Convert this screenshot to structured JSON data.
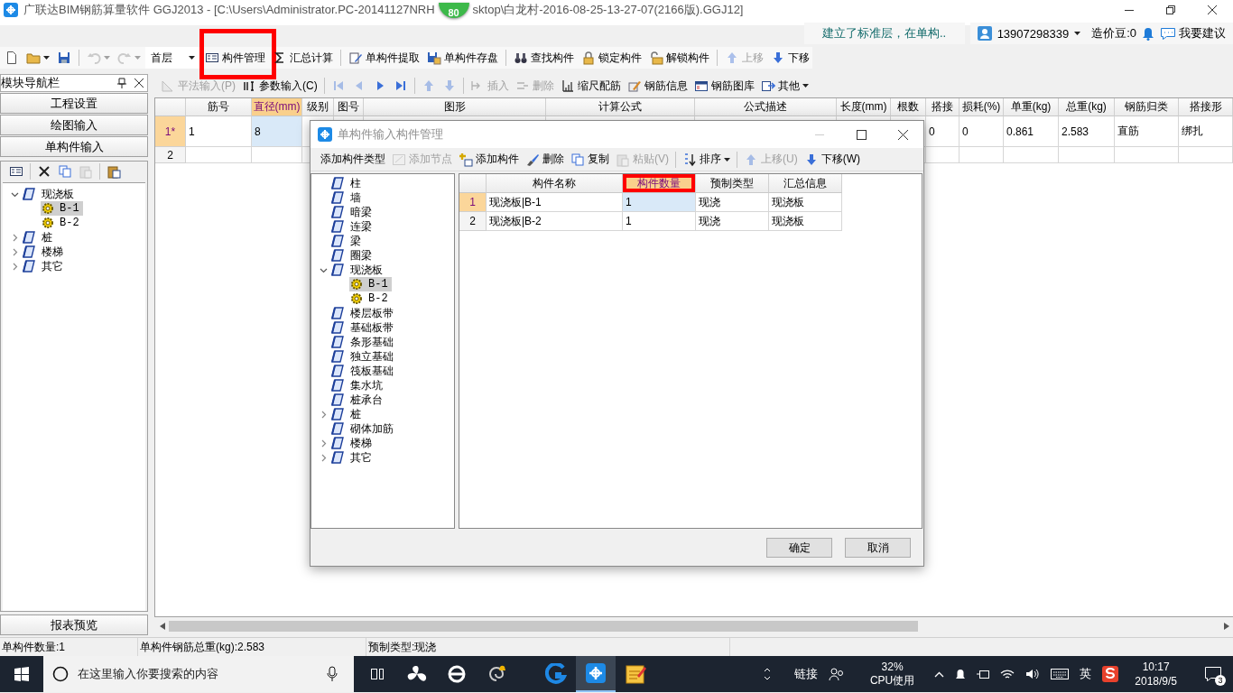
{
  "window": {
    "title_parts": [
      "广联达BIM钢筋算量软件 GGJ2013 - [C:\\Users\\Administrator.PC-20141127NRH",
      "sktop\\白龙村-2016-08-25-13-27-07(2166版).GGJ12]"
    ],
    "badge": "80"
  },
  "info_bar": {
    "notice": "建立了标准层，在单构..",
    "user": "13907298339",
    "beans": "造价豆:0",
    "feedback": "我要建议"
  },
  "toolbar": [
    {
      "kind": "icon",
      "disabled": false
    },
    {
      "kind": "icon",
      "disabled": false,
      "menu": true
    },
    {
      "kind": "icon",
      "disabled": false
    },
    {
      "kind": "separator"
    },
    {
      "kind": "icon",
      "disabled": true,
      "menu": true
    },
    {
      "kind": "icon",
      "disabled": true,
      "menu": true
    },
    {
      "kind": "dropdown",
      "label": "首层"
    },
    {
      "kind": "button",
      "label": "构件管理",
      "disabled": false,
      "highlighted": true
    },
    {
      "kind": "button",
      "label": "汇总计算",
      "disabled": false
    },
    {
      "kind": "separator"
    },
    {
      "kind": "button",
      "label": "单构件提取",
      "disabled": false
    },
    {
      "kind": "button",
      "label": "单构件存盘",
      "disabled": false
    },
    {
      "kind": "separator"
    },
    {
      "kind": "button",
      "label": "查找构件",
      "disabled": false
    },
    {
      "kind": "button",
      "label": "锁定构件",
      "disabled": false
    },
    {
      "kind": "button",
      "label": "解锁构件",
      "disabled": false
    },
    {
      "kind": "separator"
    },
    {
      "kind": "button",
      "label": "上移",
      "disabled": true
    },
    {
      "kind": "button",
      "label": "下移",
      "disabled": false
    }
  ],
  "nav": {
    "title": "模块导航栏",
    "sections": [
      "工程设置",
      "绘图输入",
      "单构件输入"
    ],
    "toolbar": [
      {
        "kind": "icon",
        "disabled": false
      },
      {
        "kind": "separator"
      },
      {
        "kind": "icon",
        "disabled": false
      },
      {
        "kind": "icon",
        "disabled": false
      },
      {
        "kind": "icon",
        "disabled": true
      },
      {
        "kind": "separator"
      },
      {
        "kind": "icon",
        "disabled": false
      }
    ],
    "tree": [
      {
        "label": "现浇板",
        "kind": "category",
        "expanded": true,
        "selected": false,
        "children": [
          {
            "label": "B-1",
            "kind": "component",
            "selected": true
          },
          {
            "label": "B-2",
            "kind": "component",
            "selected": false
          }
        ]
      },
      {
        "label": "桩",
        "kind": "category",
        "expanded": false,
        "selected": false
      },
      {
        "label": "楼梯",
        "kind": "category",
        "expanded": false,
        "selected": false
      },
      {
        "label": "其它",
        "kind": "category",
        "expanded": false,
        "selected": false
      }
    ],
    "footer": "报表预览"
  },
  "grid_toolbar": [
    {
      "kind": "button",
      "label": "平法输入(P)",
      "disabled": true
    },
    {
      "kind": "button",
      "label": "参数输入(C)",
      "disabled": false
    },
    {
      "kind": "separator"
    },
    {
      "kind": "icon",
      "disabled": true
    },
    {
      "kind": "icon",
      "disabled": true
    },
    {
      "kind": "icon",
      "disabled": false
    },
    {
      "kind": "icon",
      "disabled": false
    },
    {
      "kind": "separator"
    },
    {
      "kind": "icon",
      "disabled": true
    },
    {
      "kind": "icon",
      "disabled": true
    },
    {
      "kind": "separator"
    },
    {
      "kind": "button",
      "label": "插入",
      "disabled": true
    },
    {
      "kind": "button",
      "label": "删除",
      "disabled": true
    },
    {
      "kind": "button",
      "label": "缩尺配筋",
      "disabled": false
    },
    {
      "kind": "button",
      "label": "钢筋信息",
      "disabled": false
    },
    {
      "kind": "button",
      "label": "钢筋图库",
      "disabled": false
    },
    {
      "kind": "button",
      "label": "其他",
      "disabled": false,
      "menu": true
    }
  ],
  "grid": {
    "columns": [
      {
        "label": "筋号",
        "selected": false
      },
      {
        "label": "直径(mm)",
        "selected": true
      },
      {
        "label": "级别",
        "selected": false
      },
      {
        "label": "图号",
        "selected": false
      },
      {
        "label": "图形",
        "selected": false
      },
      {
        "label": "计算公式",
        "selected": false
      },
      {
        "label": "公式描述",
        "selected": false
      },
      {
        "label": "长度(mm)",
        "selected": false
      },
      {
        "label": "根数",
        "selected": false
      },
      {
        "label": "搭接",
        "selected": false
      },
      {
        "label": "损耗(%)",
        "selected": false
      },
      {
        "label": "单重(kg)",
        "selected": false
      },
      {
        "label": "总重(kg)",
        "selected": false
      },
      {
        "label": "钢筋归类",
        "selected": false
      },
      {
        "label": "搭接形",
        "selected": false
      }
    ],
    "rows": [
      {
        "header": "1*",
        "selected": true,
        "cells": [
          "1",
          "8",
          null,
          null,
          null,
          null,
          null,
          null,
          null,
          "0",
          "0",
          "0.861",
          "2.583",
          "直筋",
          "绑扎"
        ]
      },
      {
        "header": "2",
        "selected": false
      }
    ]
  },
  "dialog": {
    "title": "单构件输入构件管理",
    "toolbar": [
      {
        "kind": "button",
        "label": "添加构件类型",
        "disabled": false
      },
      {
        "kind": "button",
        "label": "添加节点",
        "disabled": true
      },
      {
        "kind": "button",
        "label": "添加构件",
        "disabled": false
      },
      {
        "kind": "button",
        "label": "删除",
        "disabled": false
      },
      {
        "kind": "button",
        "label": "复制",
        "disabled": false
      },
      {
        "kind": "button",
        "label": "粘贴(V)",
        "disabled": true
      },
      {
        "kind": "separator"
      },
      {
        "kind": "button",
        "label": "排序",
        "disabled": false,
        "menu": true
      },
      {
        "kind": "separator"
      },
      {
        "kind": "button",
        "label": "上移(U)",
        "disabled": true
      },
      {
        "kind": "button",
        "label": "下移(W)",
        "disabled": false
      }
    ],
    "tree": [
      {
        "label": "柱",
        "kind": "category",
        "selected": false
      },
      {
        "label": "墙",
        "kind": "category",
        "selected": false
      },
      {
        "label": "暗梁",
        "kind": "category",
        "selected": false
      },
      {
        "label": "连梁",
        "kind": "category",
        "selected": false
      },
      {
        "label": "梁",
        "kind": "category",
        "selected": false
      },
      {
        "label": "圈梁",
        "kind": "category",
        "selected": false
      },
      {
        "label": "现浇板",
        "kind": "category",
        "expanded": true,
        "selected": false,
        "children": [
          {
            "label": "B-1",
            "kind": "component",
            "selected": true
          },
          {
            "label": "B-2",
            "kind": "component",
            "selected": false
          }
        ]
      },
      {
        "label": "楼层板带",
        "kind": "category",
        "selected": false
      },
      {
        "label": "基础板带",
        "kind": "category",
        "selected": false
      },
      {
        "label": "条形基础",
        "kind": "category",
        "selected": false
      },
      {
        "label": "独立基础",
        "kind": "category",
        "selected": false
      },
      {
        "label": "筏板基础",
        "kind": "category",
        "selected": false
      },
      {
        "label": "集水坑",
        "kind": "category",
        "selected": false
      },
      {
        "label": "桩承台",
        "kind": "category",
        "selected": false
      },
      {
        "label": "桩",
        "kind": "category",
        "expanded": false,
        "selected": false
      },
      {
        "label": "砌体加筋",
        "kind": "category",
        "selected": false
      },
      {
        "label": "楼梯",
        "kind": "category",
        "expanded": false,
        "selected": false
      },
      {
        "label": "其它",
        "kind": "category",
        "expanded": false,
        "selected": false
      }
    ],
    "grid": {
      "columns": [
        {
          "label": "构件名称",
          "selected": false
        },
        {
          "label": "构件数量",
          "selected": true,
          "highlighted": true
        },
        {
          "label": "预制类型",
          "selected": false
        },
        {
          "label": "汇总信息",
          "selected": false
        }
      ],
      "rows": [
        {
          "header": "1",
          "selected": true,
          "cells": [
            "现浇板|B-1",
            "1",
            "现浇",
            "现浇板"
          ]
        },
        {
          "header": "2",
          "selected": false,
          "cells": [
            "现浇板|B-2",
            "1",
            "现浇",
            "现浇板"
          ]
        }
      ]
    },
    "buttons": [
      "确定",
      "取消"
    ]
  },
  "status_bar": [
    "单构件数量:1",
    "单构件钢筋总重(kg):2.583",
    "预制类型:现浇"
  ],
  "taskbar": {
    "search_placeholder": "在这里输入你要搜索的内容",
    "apps": [
      {
        "active": false
      },
      {
        "active": false
      },
      {
        "active": false
      },
      {
        "active": false
      },
      {
        "active": true
      },
      {
        "active": false
      }
    ],
    "link_label": "链接",
    "cpu": "32%",
    "cpu_label": "CPU使用",
    "ime": "英",
    "time": "10:17",
    "date": "2018/9/5",
    "notifications": "3"
  }
}
